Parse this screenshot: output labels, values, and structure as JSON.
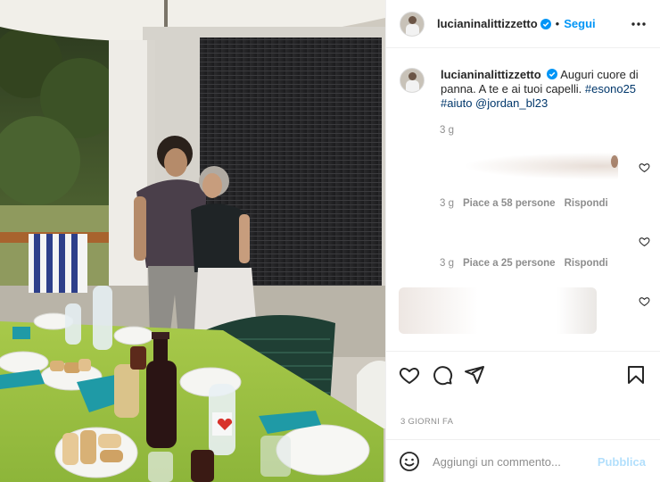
{
  "post": {
    "username": "lucianinalittizzetto",
    "separator": "•",
    "follow_label": "Segui",
    "more_icon": "more-horizontal-icon"
  },
  "caption": {
    "username": "lucianinalittizzetto",
    "text": "Auguri cuore di panna. A te e ai tuoi capelli.",
    "hashtag_1": "#esono25",
    "hashtag_2": "#aiuto",
    "mention": "@jordan_bl23",
    "time": "3 g"
  },
  "comments": [
    {
      "time": "3 g",
      "likes": "Piace a 58 persone",
      "reply": "Rispondi"
    },
    {
      "time": "3 g",
      "likes": "Piace a 25 persone",
      "reply": "Rispondi"
    }
  ],
  "actions": {
    "like_icon": "heart-icon",
    "comment_icon": "comment-icon",
    "share_icon": "send-icon",
    "save_icon": "bookmark-icon"
  },
  "post_date": "3 GIORNI FA",
  "add_comment": {
    "placeholder": "Aggiungi un commento...",
    "publish_label": "Pubblica"
  },
  "colors": {
    "accent": "#0095f6",
    "publish_disabled": "#b2dffc",
    "muted": "#8e8e8e",
    "border": "#efefef"
  }
}
